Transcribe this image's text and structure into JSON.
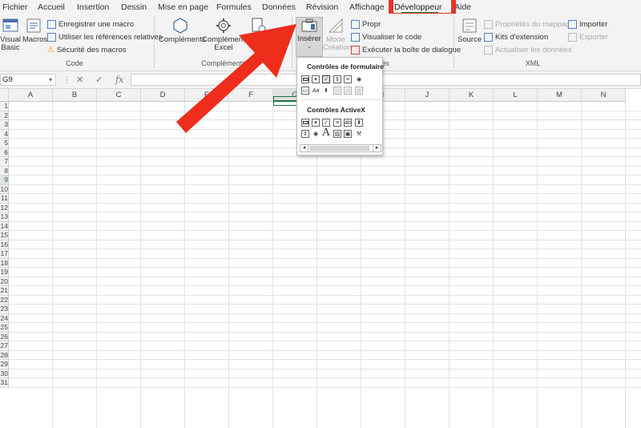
{
  "tabs": [
    "Fichier",
    "Accueil",
    "Insertion",
    "Dessin",
    "Mise en page",
    "Formules",
    "Données",
    "Révision",
    "Affichage",
    "Développeur",
    "Aide"
  ],
  "active_tab": "Développeur",
  "ribbon": {
    "code": {
      "label": "Code",
      "visual_basic": "Visual Basic",
      "macros": "Macros",
      "record_macro": "Enregistrer une macro",
      "relative_refs": "Utiliser les références relatives",
      "macro_security": "Sécurité des macros"
    },
    "complements": {
      "label": "Compléments",
      "complements": "Compléments",
      "excel_complements": "Compléments Excel",
      "com_partial": "Co"
    },
    "controls": {
      "label": "es",
      "insert": "Insérer",
      "design_mode": "Mode Création",
      "properties": "Propr",
      "view_code": "Visualiser le code",
      "run_dialog": "Exécuter la boîte de dialogue"
    },
    "xml": {
      "label": "XML",
      "source": "Source",
      "map_props": "Propriétés du mappage",
      "extension_packs": "Kits d'extension",
      "refresh_data": "Actualiser les données",
      "import": "Importer",
      "export": "Exporter"
    }
  },
  "formula_bar": {
    "name_box": "G9",
    "fx": "fx",
    "value": ""
  },
  "grid": {
    "columns": [
      "A",
      "B",
      "C",
      "D",
      "E",
      "F",
      "G",
      "H",
      "I",
      "J",
      "K",
      "L",
      "M",
      "N"
    ],
    "rows": [
      "1",
      "2",
      "3",
      "4",
      "5",
      "6",
      "7",
      "8",
      "9",
      "10",
      "11",
      "12",
      "13",
      "14",
      "15",
      "16",
      "17",
      "18",
      "19",
      "20",
      "21",
      "22",
      "23",
      "24",
      "25",
      "26",
      "27",
      "28",
      "29",
      "30",
      "31"
    ],
    "selected_cell": "G9"
  },
  "dropdown": {
    "form_controls_title": "Contrôles de formulaire",
    "activex_title": "Contrôles ActiveX"
  },
  "colors": {
    "accent_green": "#217346",
    "highlight_red": "#e53525"
  }
}
